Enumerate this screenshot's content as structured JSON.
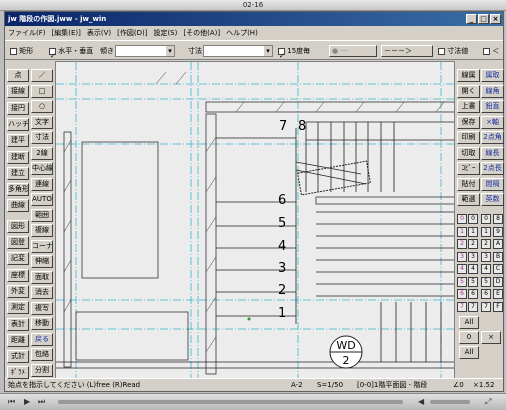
{
  "system_title": "02-16",
  "window": {
    "title": "jw 階段の作図.jww - jw_win",
    "btn_min": "_",
    "btn_max": "□",
    "btn_close": "×"
  },
  "menu": [
    "ファイル(F)",
    "[編集(E)]",
    "表示(V)",
    "[作図(D)]",
    "設定(S)",
    "[その他(A)]",
    "ヘルプ(H)"
  ],
  "toolbar": {
    "rect_label": "矩形",
    "hv_label": "水平・垂直",
    "slope_label": "傾き",
    "dim_label": "寸法",
    "angle_label": "15度毎",
    "arrow_label": "－－－＞",
    "dimval_label": "寸法値",
    "lt_label": "＜"
  },
  "left_tools": [
    "点",
    "接線",
    "接円",
    "ハッチ",
    "建平",
    "建断",
    "建立",
    "多角形",
    "曲線",
    "図形",
    "図登",
    "記変",
    "座標",
    "外変",
    "測定",
    "表計",
    "距離",
    "式計",
    "ﾎﾟﾗﾒ"
  ],
  "left_tools2": [
    "／",
    "□",
    "○",
    "文字",
    "寸法",
    "2線",
    "中心線",
    "連線",
    "AUTO",
    "範囲",
    "複線",
    "コーナー",
    "伸縮",
    "面取",
    "消去",
    "複写",
    "移動",
    "戻る",
    "包絡",
    "分割"
  ],
  "right_tools": [
    "線属",
    "開く",
    "上書",
    "保存",
    "印刷",
    "切取",
    "ｺﾋﾟｰ",
    "貼付",
    "範囲",
    "線角",
    "鉛直",
    "×軸",
    "2点角",
    "線長",
    "2点長",
    "間隔",
    "測定",
    "英",
    "進角"
  ],
  "right_tools_a": [
    "線属",
    "開く",
    "上書",
    "保存",
    "印刷",
    "切取",
    "ｺﾋﾟｰ",
    "貼付",
    "範選"
  ],
  "right_tools_b": [
    "属取",
    "線角",
    "鉛直",
    "×軸",
    "2点角",
    "線長",
    "2点長",
    "間隔",
    "英数"
  ],
  "layer_nums": [
    "0",
    "1",
    "2",
    "3",
    "4",
    "5",
    "6",
    "7",
    "8",
    "9",
    "A",
    "B",
    "C",
    "D",
    "E",
    "F"
  ],
  "layer_all": "All",
  "layer_zero": "0",
  "layer_x": "×",
  "drawing": {
    "steps": [
      "7",
      "8",
      "6",
      "5",
      "4",
      "3",
      "2",
      "1"
    ],
    "wd_top": "WD",
    "wd_bottom": "2"
  },
  "status": {
    "msg": "始点を指示してください (L)free (R)Read",
    "paper": "A-2",
    "scale": "S=1/50",
    "layer": "[0-0]1階平面図 - 階段",
    "angle": "∠0",
    "zoom": "×1.52"
  }
}
